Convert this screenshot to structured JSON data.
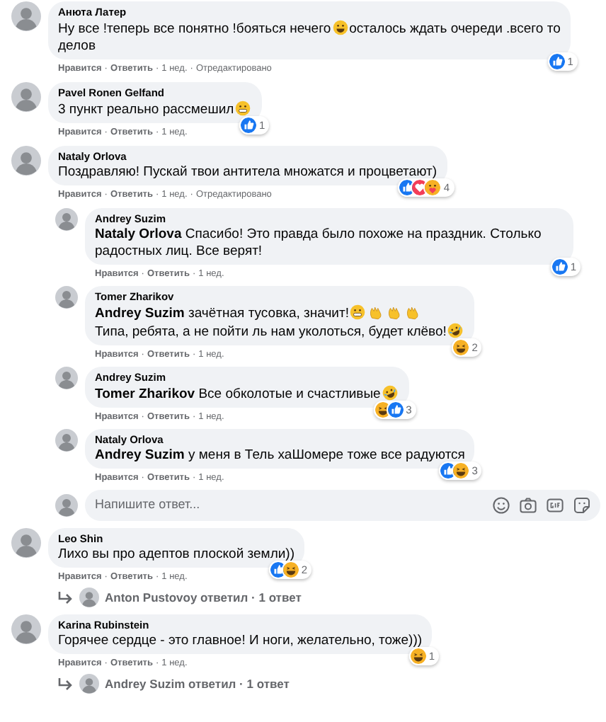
{
  "separator": "·",
  "comments": [
    {
      "author": "Анюта Латер",
      "lines": [
        [
          {
            "text": "Ну все !теперь все понятно !бояться нечего",
            "emoji": [
              {
                "kind": "laugh"
              }
            ]
          },
          {
            "text": "осталось ждать очереди .всего то"
          }
        ],
        [
          {
            "text": "делов"
          }
        ]
      ],
      "reactions": {
        "items": [
          {
            "kind": "like"
          }
        ],
        "count": "1"
      },
      "meta": [
        "Нравится",
        "Ответить",
        "1 нед.",
        "Отредактировано"
      ]
    },
    {
      "author": "Pavel Ronen Gelfand",
      "lines": [
        [
          {
            "text": "3 пункт реально рассмешил",
            "emoji": [
              {
                "kind": "grin"
              }
            ]
          }
        ]
      ],
      "reactions": {
        "items": [
          {
            "kind": "like"
          }
        ],
        "count": "1"
      },
      "meta": [
        "Нравится",
        "Ответить",
        "1 нед."
      ]
    },
    {
      "author": "Nataly Orlova",
      "lines": [
        [
          {
            "text": "Поздравляю! Пускай твои антитела множатся и процветают)"
          }
        ]
      ],
      "reactions": {
        "items": [
          {
            "kind": "like"
          },
          {
            "kind": "love"
          },
          {
            "kind": "care"
          }
        ],
        "count": "4"
      },
      "meta": [
        "Нравится",
        "Ответить",
        "1 нед.",
        "Отредактировано"
      ],
      "replies": [
        {
          "author": "Andrey Suzim",
          "lines": [
            [
              {
                "text": "**Nataly Orlova** Спасибо! Это правда было похоже на праздник. Столько радостных лиц. Все верят!"
              }
            ]
          ],
          "reactions": {
            "items": [
              {
                "kind": "like"
              }
            ],
            "count": "1"
          },
          "meta": [
            "Нравится",
            "Ответить",
            "1 нед."
          ]
        },
        {
          "author": "Tomer Zharikov",
          "lines": [
            [
              {
                "text": "**Andrey Suzim** зачётная тусовка, значит!",
                "emoji": [
                  {
                    "kind": "grin"
                  },
                  {
                    "kind": "clap"
                  },
                  {
                    "kind": "clap"
                  },
                  {
                    "kind": "clap"
                  }
                ]
              }
            ],
            [
              {
                "text": "Типа, ребята, а не пойти ль нам уколоться, будет клёво!",
                "emoji": [
                  {
                    "kind": "rofl"
                  }
                ]
              }
            ]
          ],
          "reactions": {
            "items": [
              {
                "kind": "haha"
              }
            ],
            "count": "2"
          },
          "meta": [
            "Нравится",
            "Ответить",
            "1 нед."
          ]
        },
        {
          "author": "Andrey Suzim",
          "lines": [
            [
              {
                "text": "**Tomer Zharikov** Все обколотые и счастливые",
                "emoji": [
                  {
                    "kind": "rofl"
                  }
                ]
              }
            ]
          ],
          "reactions": {
            "items": [
              {
                "kind": "haha"
              },
              {
                "kind": "like"
              }
            ],
            "count": "3"
          },
          "meta": [
            "Нравится",
            "Ответить",
            "1 нед."
          ]
        },
        {
          "author": "Nataly Orlova",
          "lines": [
            [
              {
                "text": "**Andrey Suzim** у меня в Тель хаШомере тоже все радуются"
              }
            ]
          ],
          "reactions": {
            "items": [
              {
                "kind": "like"
              },
              {
                "kind": "haha"
              }
            ],
            "count": "3"
          },
          "meta": [
            "Нравится",
            "Ответить",
            "1 нед."
          ]
        }
      ],
      "reply_input": {
        "placeholder": "Напишите ответ..."
      }
    },
    {
      "author": "Leo Shin",
      "lines": [
        [
          {
            "text": "Лихо вы про адептов плоской земли))"
          }
        ]
      ],
      "reactions": {
        "items": [
          {
            "kind": "like"
          },
          {
            "kind": "haha"
          }
        ],
        "count": "2"
      },
      "meta": [
        "Нравится",
        "Ответить",
        "1 нед."
      ],
      "replies_link": "Anton Pustovoy ответил · 1 ответ"
    },
    {
      "author": "Karina Rubinstein",
      "lines": [
        [
          {
            "text": "Горячее сердце - это главное! И ноги, желательно, тоже)))"
          }
        ]
      ],
      "reactions": {
        "items": [
          {
            "kind": "haha"
          }
        ],
        "count": "1"
      },
      "meta": [
        "Нравится",
        "Ответить",
        "1 нед."
      ],
      "replies_link": "Andrey Suzim ответил · 1 ответ"
    }
  ]
}
